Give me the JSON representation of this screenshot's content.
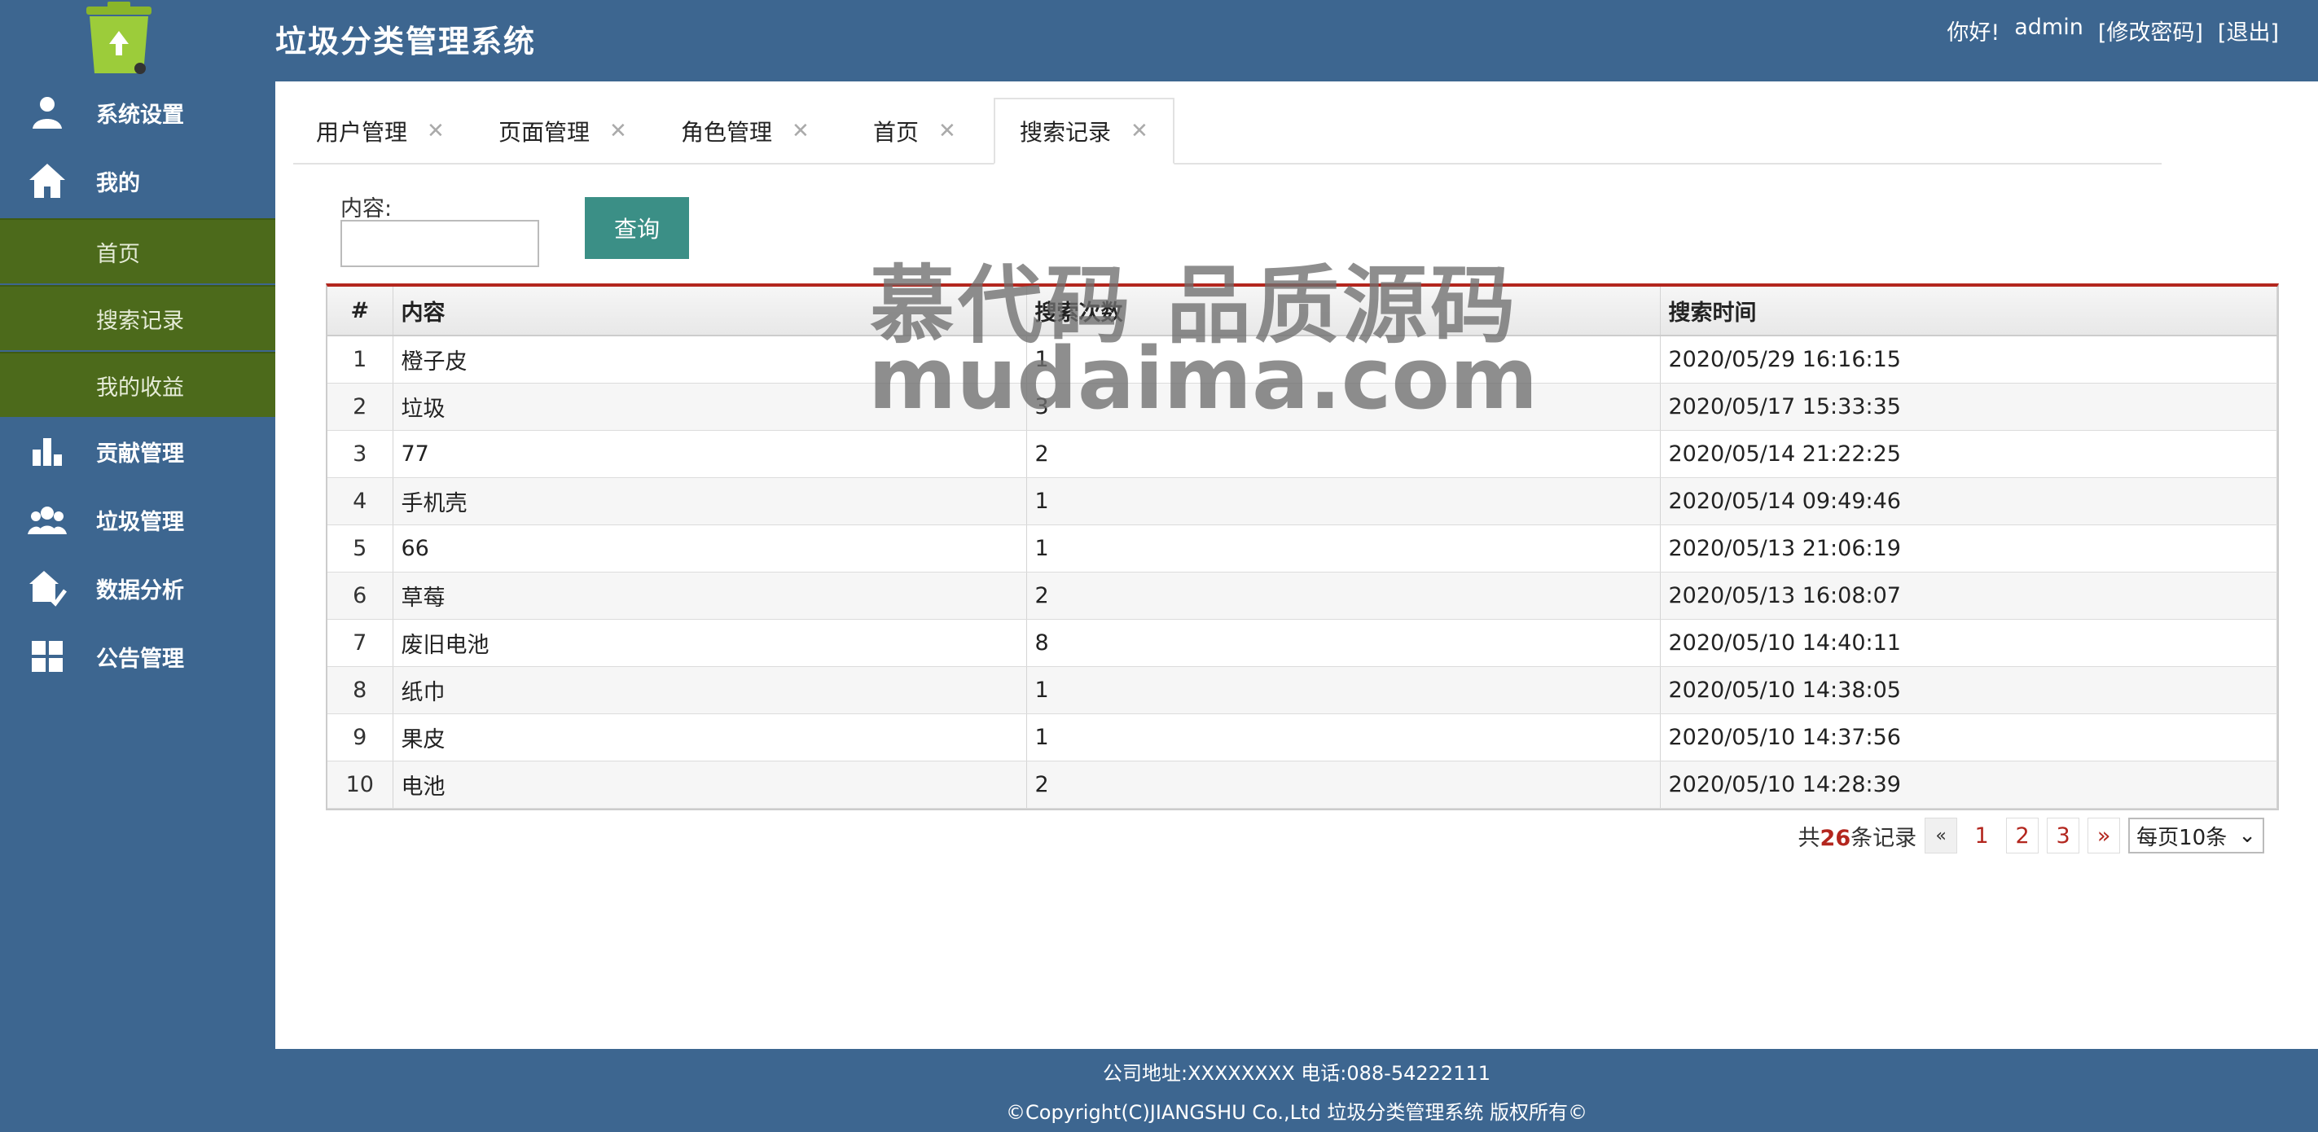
{
  "app": {
    "title": "垃圾分类管理系统",
    "greeting": "你好!",
    "user": "admin",
    "change_password": "[修改密码]",
    "logout": "[退出]"
  },
  "sidebar": {
    "items": [
      {
        "label": "系统设置",
        "icon": "user-settings-icon"
      },
      {
        "label": "我的",
        "icon": "home-icon"
      },
      {
        "label": "首页"
      },
      {
        "label": "搜索记录"
      },
      {
        "label": "我的收益"
      },
      {
        "label": "贡献管理",
        "icon": "bar-chart-icon"
      },
      {
        "label": "垃圾管理",
        "icon": "users-icon"
      },
      {
        "label": "数据分析",
        "icon": "house-check-icon"
      },
      {
        "label": "公告管理",
        "icon": "grid-icon"
      }
    ]
  },
  "tabs": [
    {
      "label": "用户管理"
    },
    {
      "label": "页面管理"
    },
    {
      "label": "角色管理"
    },
    {
      "label": "首页"
    },
    {
      "label": "搜索记录",
      "active": true
    }
  ],
  "search": {
    "label": "内容:",
    "value": "",
    "button": "查询"
  },
  "table": {
    "headers": [
      "#",
      "内容",
      "搜索次数",
      "搜索时间"
    ],
    "rows": [
      [
        "1",
        "橙子皮",
        "1",
        "2020/05/29 16:16:15"
      ],
      [
        "2",
        "垃圾",
        "3",
        "2020/05/17 15:33:35"
      ],
      [
        "3",
        "77",
        "2",
        "2020/05/14 21:22:25"
      ],
      [
        "4",
        "手机壳",
        "1",
        "2020/05/14 09:49:46"
      ],
      [
        "5",
        "66",
        "1",
        "2020/05/13 21:06:19"
      ],
      [
        "6",
        "草莓",
        "2",
        "2020/05/13 16:08:07"
      ],
      [
        "7",
        "废旧电池",
        "8",
        "2020/05/10 14:40:11"
      ],
      [
        "8",
        "纸巾",
        "1",
        "2020/05/10 14:38:05"
      ],
      [
        "9",
        "果皮",
        "1",
        "2020/05/10 14:37:56"
      ],
      [
        "10",
        "电池",
        "2",
        "2020/05/10 14:28:39"
      ]
    ]
  },
  "pagination": {
    "prefix": "共",
    "total": "26",
    "suffix": "条记录",
    "prev": "«",
    "pages": [
      "1",
      "2",
      "3"
    ],
    "next": "»",
    "per_page": "每页10条"
  },
  "watermark": {
    "line1": "慕代码 品质源码",
    "line2": "mudaima.com"
  },
  "footer": {
    "line1": "公司地址:XXXXXXXX 电话:088-54222111",
    "line2": "©Copyright(C)JIANGSHU Co.,Ltd 垃圾分类管理系统 版权所有©"
  },
  "colors": {
    "sidebar_bg": "#3d6690",
    "submenu_bg": "#4c6a1b",
    "button_bg": "#3b8f86",
    "accent_red": "#b3261e"
  }
}
